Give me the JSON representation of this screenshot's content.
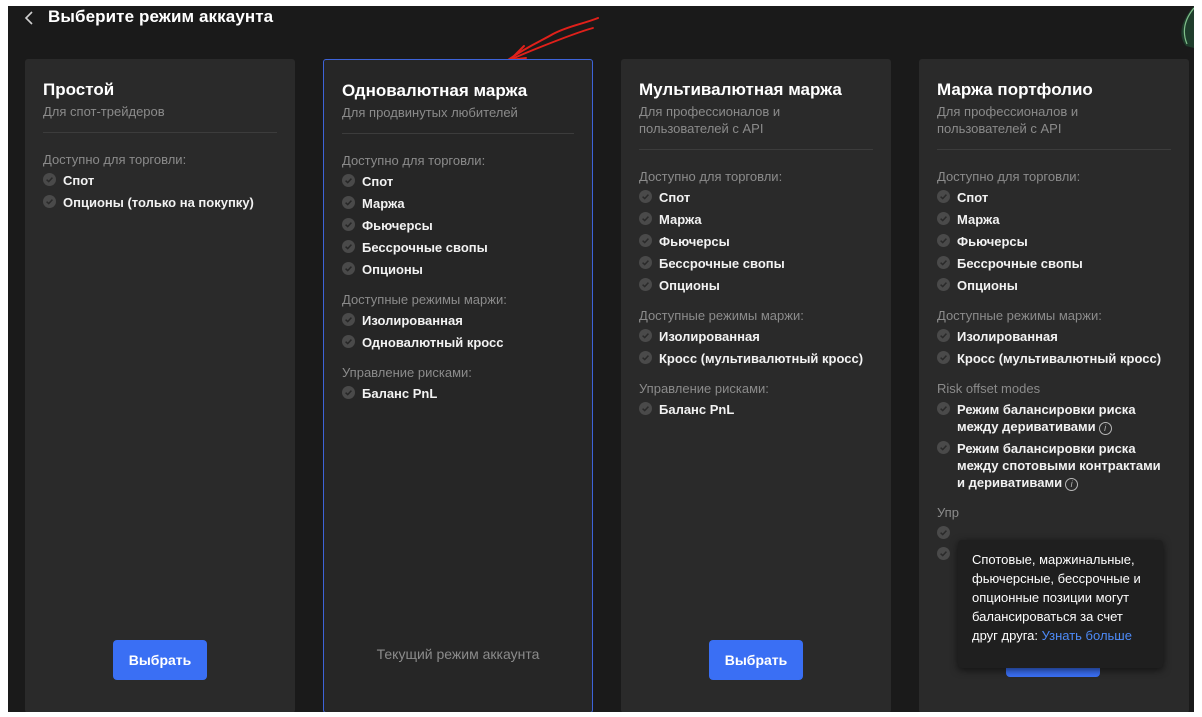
{
  "header": {
    "title": "Выберите режим аккаунта",
    "back_icon": "chevron-left-icon"
  },
  "cards": [
    {
      "title": "Простой",
      "subtitle": "Для спот-трейдеров",
      "sections": [
        {
          "title": "Доступно для торговли:",
          "items": [
            "Спот",
            "Опционы (только на покупку)"
          ]
        }
      ],
      "button_label": "Выбрать"
    },
    {
      "title": "Одновалютная маржа",
      "subtitle": "Для продвинутых любителей",
      "sections": [
        {
          "title": "Доступно для торговли:",
          "items": [
            "Спот",
            "Маржа",
            "Фьючерсы",
            "Бессрочные свопы",
            "Опционы"
          ]
        },
        {
          "title": "Доступные режимы маржи:",
          "items": [
            "Изолированная",
            "Одновалютный кросс"
          ]
        },
        {
          "title": "Управление рисками:",
          "items": [
            "Баланс PnL"
          ]
        }
      ],
      "current_mode_label": "Текущий режим аккаунта",
      "selected": true
    },
    {
      "title": "Мультивалютная маржа",
      "subtitle": "Для профессионалов и пользователей с API",
      "sections": [
        {
          "title": "Доступно для торговли:",
          "items": [
            "Спот",
            "Маржа",
            "Фьючерсы",
            "Бессрочные свопы",
            "Опционы"
          ]
        },
        {
          "title": "Доступные режимы маржи:",
          "items": [
            "Изолированная",
            "Кросс (мультивалютный кросс)"
          ]
        },
        {
          "title": "Управление рисками:",
          "items": [
            "Баланс PnL"
          ]
        }
      ],
      "button_label": "Выбрать"
    },
    {
      "title": "Маржа портфолио",
      "subtitle": "Для профессионалов и пользователей с API",
      "sections": [
        {
          "title": "Доступно для торговли:",
          "items": [
            "Спот",
            "Маржа",
            "Фьючерсы",
            "Бессрочные свопы",
            "Опционы"
          ]
        },
        {
          "title": "Доступные режимы маржи:",
          "items": [
            "Изолированная",
            "Кросс (мультивалютный кросс)"
          ]
        },
        {
          "title": "Risk offset modes",
          "items": [
            "Режим балансировки риска между деривативами",
            "Режим балансировки риска между спотовыми контрактами и деривативами"
          ],
          "info_icons": true
        }
      ],
      "partial_section_title": "Упр"
    }
  ],
  "tooltip": {
    "text": "Спотовые, маржинальные, фьючерсные, бессрочные и опционные позиции могут балансироваться за счет друг друга: ",
    "link": "Узнать больше"
  },
  "colors": {
    "background": "#1a1a1a",
    "card": "#2a2a2a",
    "accent": "#3a6ff4",
    "check": "#4a4a4a",
    "selected_border": "#3d63d8",
    "annotation": "#e0201a"
  }
}
